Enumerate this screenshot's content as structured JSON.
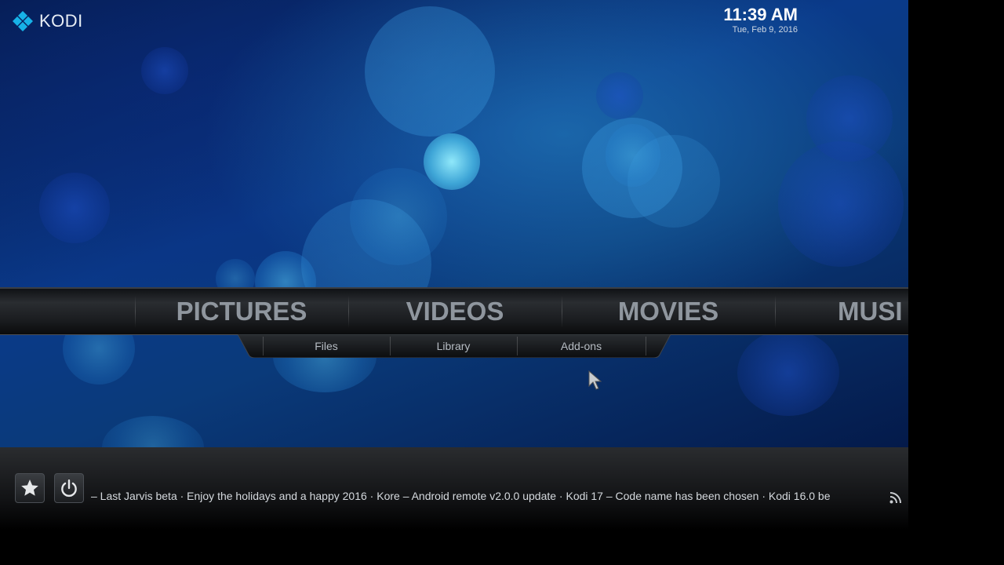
{
  "app": {
    "logo_text": "KODI"
  },
  "clock": {
    "time": "11:39 AM",
    "date": "Tue, Feb 9, 2016"
  },
  "main_menu": {
    "items": [
      {
        "label": "PICTURES"
      },
      {
        "label": "VIDEOS"
      },
      {
        "label": "MOVIES"
      },
      {
        "label": "MUSI"
      }
    ]
  },
  "submenu": {
    "items": [
      {
        "label": "Files"
      },
      {
        "label": "Library"
      },
      {
        "label": "Add-ons"
      }
    ]
  },
  "footer": {
    "favourites_icon": "star-icon",
    "power_icon": "power-icon",
    "rss_ticker": "– Last Jarvis beta · Enjoy the holidays and a happy 2016 · Kore – Android remote v2.0.0 update · Kodi 17 – Code name has been chosen · Kodi 16.0 be",
    "rss_icon": "rss-icon"
  },
  "colors": {
    "menu_text": "#8f969e",
    "submenu_text": "#b6bcc3",
    "background_blue": "#0a3a8a"
  }
}
